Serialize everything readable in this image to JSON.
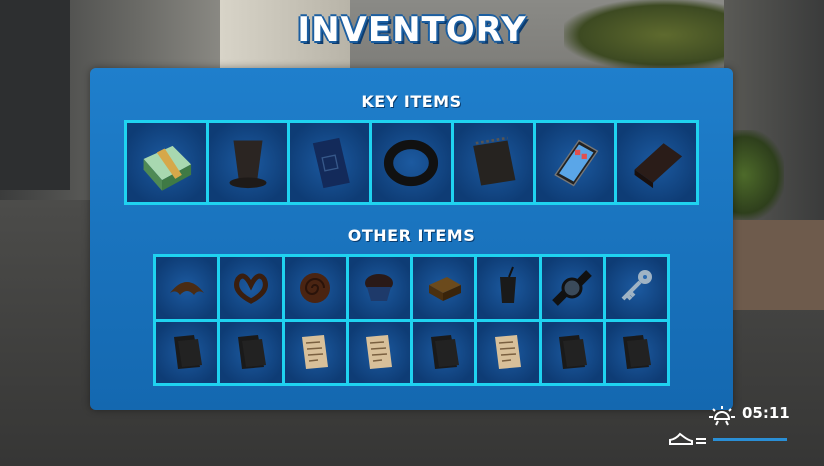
{
  "title": "INVENTORY",
  "key_items": {
    "label": "KEY ITEMS",
    "items": [
      "money-stack",
      "top-hat",
      "passport",
      "ring",
      "notepad",
      "tablet",
      "chocolate-bar"
    ]
  },
  "other_items": {
    "label": "OTHER ITEMS",
    "items": [
      "croissant",
      "pretzel",
      "cinnamon-roll",
      "cupcake",
      "cake-slice",
      "drink-cup",
      "wristwatch",
      "key",
      "dark-note",
      "dark-note",
      "paper-note",
      "paper-note",
      "dark-note",
      "paper-note",
      "dark-note",
      "dark-note"
    ]
  },
  "hud": {
    "time": "05:11",
    "time_icon": "sun-icon",
    "stamina_icon": "shoe-icon",
    "stamina": 1.0
  },
  "colors": {
    "panel": "#1a74be",
    "grid_border": "#1fd3f0",
    "cell": "#0e3c75"
  }
}
